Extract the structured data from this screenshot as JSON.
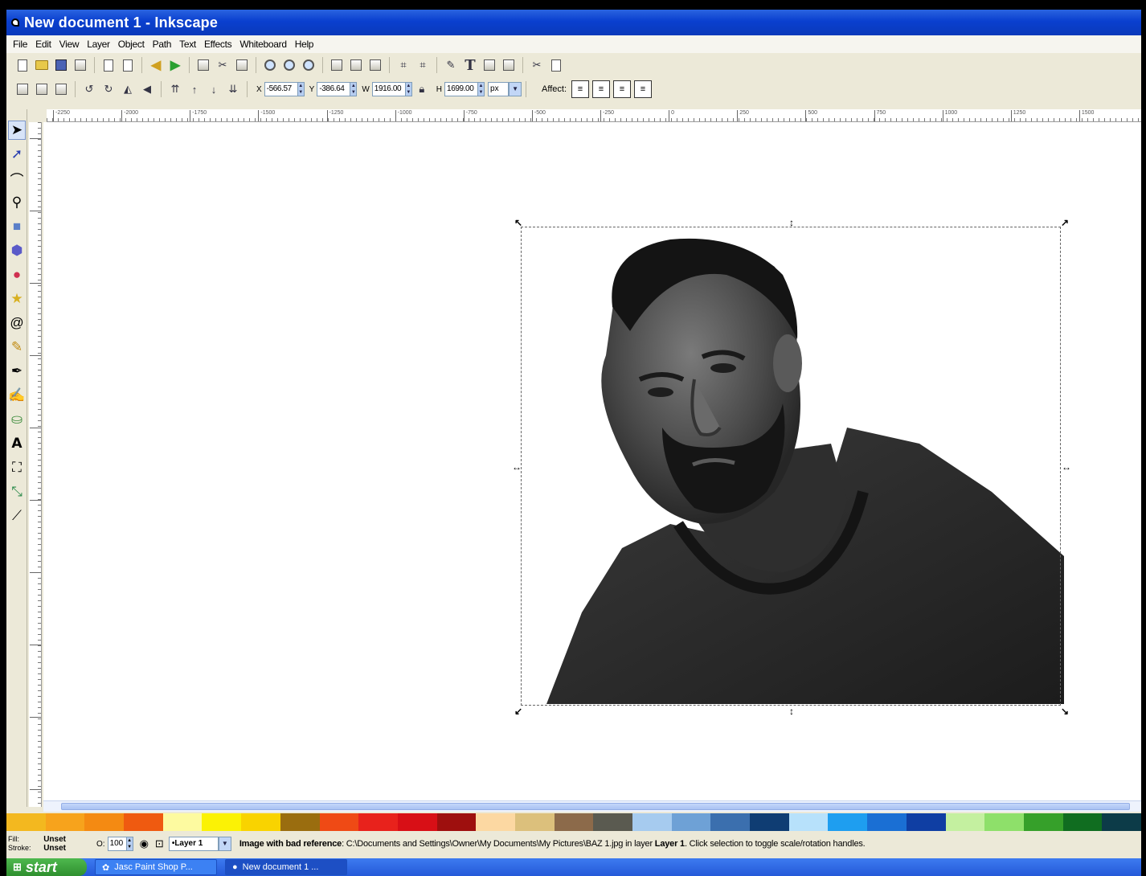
{
  "window": {
    "title": "New document 1 - Inkscape"
  },
  "menu": [
    "File",
    "Edit",
    "View",
    "Layer",
    "Object",
    "Path",
    "Text",
    "Effects",
    "Whiteboard",
    "Help"
  ],
  "toolbar": {
    "x_label": "X",
    "x_value": "-566.57",
    "y_label": "Y",
    "y_value": "-386.64",
    "w_label": "W",
    "w_value": "1916.00",
    "h_label": "H",
    "h_value": "1699.00",
    "unit": "px",
    "affect_label": "Affect:"
  },
  "ruler": {
    "ticks": [
      "-2250",
      "-2000",
      "-1750",
      "-1500",
      "-1250",
      "-1000",
      "-750",
      "-500",
      "-250",
      "0",
      "250",
      "500",
      "750",
      "1000",
      "1250",
      "1500"
    ]
  },
  "palette": [
    "#f3b81f",
    "#f7a31c",
    "#f48a12",
    "#ef5a10",
    "#fdfaa0",
    "#fbf205",
    "#f9d300",
    "#9a6d0f",
    "#ef4a15",
    "#e8221c",
    "#d80f16",
    "#9e0f0e",
    "#fcd8a2",
    "#dcc07c",
    "#8c6a4a",
    "#5a5a50",
    "#a6cbef",
    "#6ea1d6",
    "#3b6fae",
    "#0f3d73",
    "#b7e1fb",
    "#1e9ef0",
    "#1a6fd4",
    "#0f3ea3",
    "#c4f0a0",
    "#8ee06a",
    "#36a02a",
    "#106d20",
    "#0c3b48"
  ],
  "status": {
    "fill_label": "Fill:",
    "stroke_label": "Stroke:",
    "fill_value": "Unset",
    "stroke_value": "Unset",
    "opacity_label": "O:",
    "opacity_value": "100",
    "layer": "•Layer 1",
    "message_bold": "Image with bad reference",
    "message_path": ": C:\\Documents and Settings\\Owner\\My Documents\\My Pictures\\BAZ 1.jpg in layer ",
    "message_layer": "Layer 1",
    "message_tail": ". Click selection to toggle scale/rotation handles."
  },
  "taskbar": {
    "start": "start",
    "tasks": [
      "Jasc Paint Shop P...",
      "New document 1 ..."
    ]
  }
}
